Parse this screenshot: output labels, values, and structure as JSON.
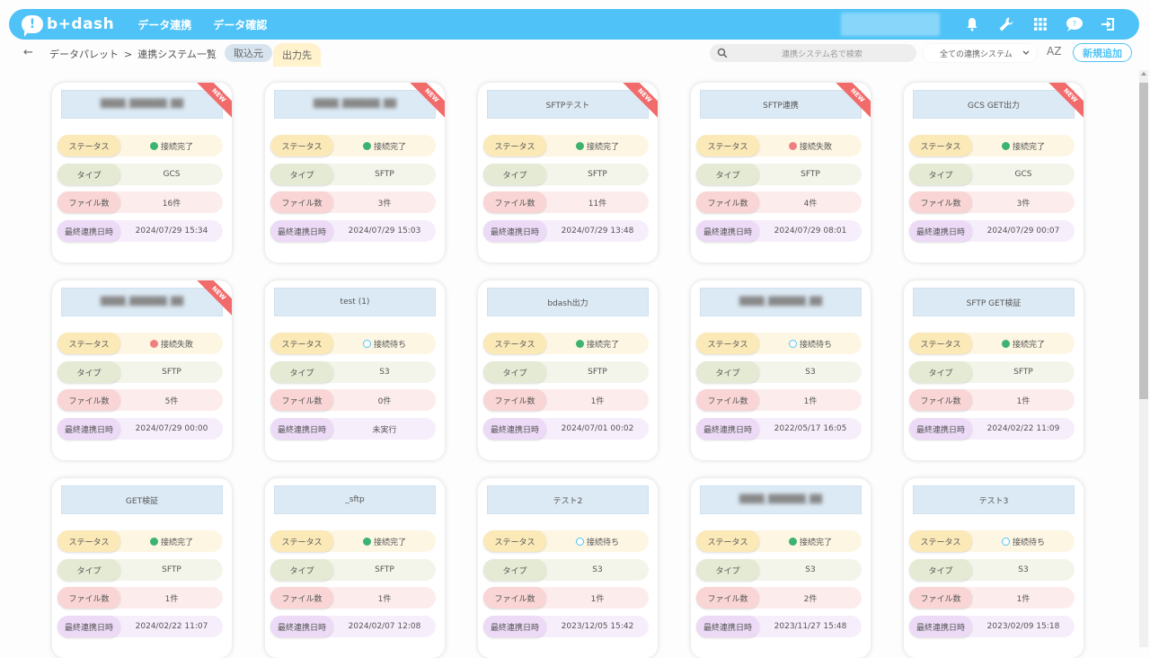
{
  "app": {
    "logo_text": "b+dash",
    "nav": [
      "データ連携",
      "データ確認"
    ],
    "colors": {
      "primary": "#4fc3f7",
      "ribbon": "#f26b6b",
      "ok": "#3cb371",
      "ng": "#f08080"
    }
  },
  "subheader": {
    "breadcrumb_root": "データパレット",
    "breadcrumb_sep": ">",
    "breadcrumb_current": "連携システム一覧",
    "tab_import": "取込元",
    "tab_export": "出力先",
    "search_placeholder": "連携システム名で検索",
    "filter_selected": "全ての連携システム",
    "sort_label": "AZ",
    "add_button": "新規追加"
  },
  "labels": {
    "status": "ステータス",
    "type": "タイプ",
    "files": "ファイル数",
    "last_date": "最終連携日時",
    "new_badge": "NEW"
  },
  "cards": [
    {
      "title": "████_██████_██",
      "blurred": true,
      "is_new": true,
      "status": "接続完了",
      "status_kind": "ok",
      "type": "GCS",
      "files": "16件",
      "date": "2024/07/29 15:34"
    },
    {
      "title": "████_██████_██",
      "blurred": true,
      "is_new": true,
      "status": "接続完了",
      "status_kind": "ok",
      "type": "SFTP",
      "files": "3件",
      "date": "2024/07/29 15:03"
    },
    {
      "title": "SFTPテスト",
      "blurred": false,
      "is_new": true,
      "status": "接続完了",
      "status_kind": "ok",
      "type": "SFTP",
      "files": "11件",
      "date": "2024/07/29 13:48"
    },
    {
      "title": "SFTP連携",
      "blurred": false,
      "is_new": true,
      "status": "接続失敗",
      "status_kind": "ng",
      "type": "SFTP",
      "files": "4件",
      "date": "2024/07/29 08:01"
    },
    {
      "title": "GCS GET出力",
      "blurred": false,
      "is_new": true,
      "status": "接続完了",
      "status_kind": "ok",
      "type": "GCS",
      "files": "3件",
      "date": "2024/07/29 00:07"
    },
    {
      "title": "████_██████_██",
      "blurred": true,
      "is_new": true,
      "status": "接続失敗",
      "status_kind": "ng",
      "type": "SFTP",
      "files": "5件",
      "date": "2024/07/29 00:00"
    },
    {
      "title": "test (1)",
      "blurred": false,
      "is_new": false,
      "status": "接続待ち",
      "status_kind": "wait",
      "type": "S3",
      "files": "0件",
      "date": "未実行"
    },
    {
      "title": "bdash出力",
      "blurred": false,
      "is_new": false,
      "status": "接続完了",
      "status_kind": "ok",
      "type": "SFTP",
      "files": "1件",
      "date": "2024/07/01 00:02"
    },
    {
      "title": "████_██████_██",
      "blurred": true,
      "is_new": false,
      "status": "接続待ち",
      "status_kind": "wait",
      "type": "S3",
      "files": "1件",
      "date": "2022/05/17 16:05"
    },
    {
      "title": "SFTP GET検証",
      "blurred": false,
      "is_new": false,
      "status": "接続完了",
      "status_kind": "ok",
      "type": "SFTP",
      "files": "1件",
      "date": "2024/02/22 11:09"
    },
    {
      "title": "GET検証",
      "blurred": false,
      "is_new": false,
      "status": "接続完了",
      "status_kind": "ok",
      "type": "SFTP",
      "files": "1件",
      "date": "2024/02/22 11:07"
    },
    {
      "title": "_sftp",
      "blurred": false,
      "is_new": false,
      "status": "接続完了",
      "status_kind": "ok",
      "type": "SFTP",
      "files": "1件",
      "date": "2024/02/07 12:08"
    },
    {
      "title": "テスト2",
      "blurred": false,
      "is_new": false,
      "status": "接続待ち",
      "status_kind": "wait",
      "type": "S3",
      "files": "1件",
      "date": "2023/12/05 15:42"
    },
    {
      "title": "████_██████_██",
      "blurred": true,
      "is_new": false,
      "status": "接続完了",
      "status_kind": "ok",
      "type": "S3",
      "files": "2件",
      "date": "2023/11/27 15:48"
    },
    {
      "title": "テスト3",
      "blurred": false,
      "is_new": false,
      "status": "接続待ち",
      "status_kind": "wait",
      "type": "S3",
      "files": "1件",
      "date": "2023/02/09 15:18"
    }
  ]
}
